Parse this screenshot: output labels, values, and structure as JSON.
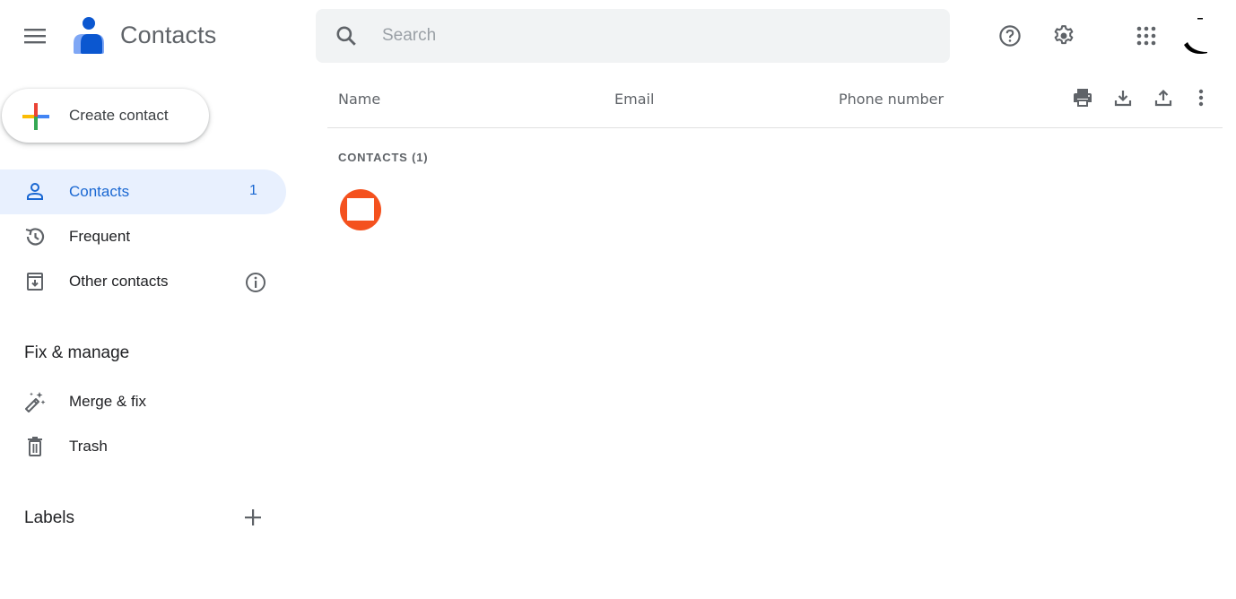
{
  "header": {
    "app_title": "Contacts",
    "search_placeholder": "Search",
    "search_value": "",
    "icons": {
      "menu": "hamburger-menu-icon",
      "logo": "contacts-person-logo",
      "search": "magnifier-icon",
      "help": "question-circle-icon",
      "settings": "gear-icon",
      "apps": "grid-dots-icon",
      "account": "account-avatar"
    }
  },
  "sidebar": {
    "create_label": "Create contact",
    "nav": [
      {
        "label": "Contacts",
        "count": "1",
        "icon": "person-outline-icon",
        "active": true
      },
      {
        "label": "Frequent",
        "icon": "history-icon"
      },
      {
        "label": "Other contacts",
        "icon": "archive-download-icon",
        "trailing_icon": "info-icon"
      }
    ],
    "fix_section_title": "Fix & manage",
    "fix_items": [
      {
        "label": "Merge & fix",
        "icon": "magic-wand-icon"
      },
      {
        "label": "Trash",
        "icon": "trash-icon"
      }
    ],
    "labels_title": "Labels"
  },
  "list": {
    "columns": [
      "Name",
      "Email",
      "Phone number"
    ],
    "toolbar": [
      "print-icon",
      "download-icon",
      "upload-icon",
      "more-vert-icon"
    ],
    "section_label": "CONTACTS (1)",
    "contacts": [
      {
        "name": "",
        "email": "",
        "phone": "",
        "avatar_color": "#f4511e"
      }
    ]
  },
  "colors": {
    "accent": "#1967d2",
    "active_bg": "#e8f0fe",
    "search_bg": "#f1f3f4",
    "avatar": "#f4511e",
    "icon_gray": "#5f6368"
  }
}
